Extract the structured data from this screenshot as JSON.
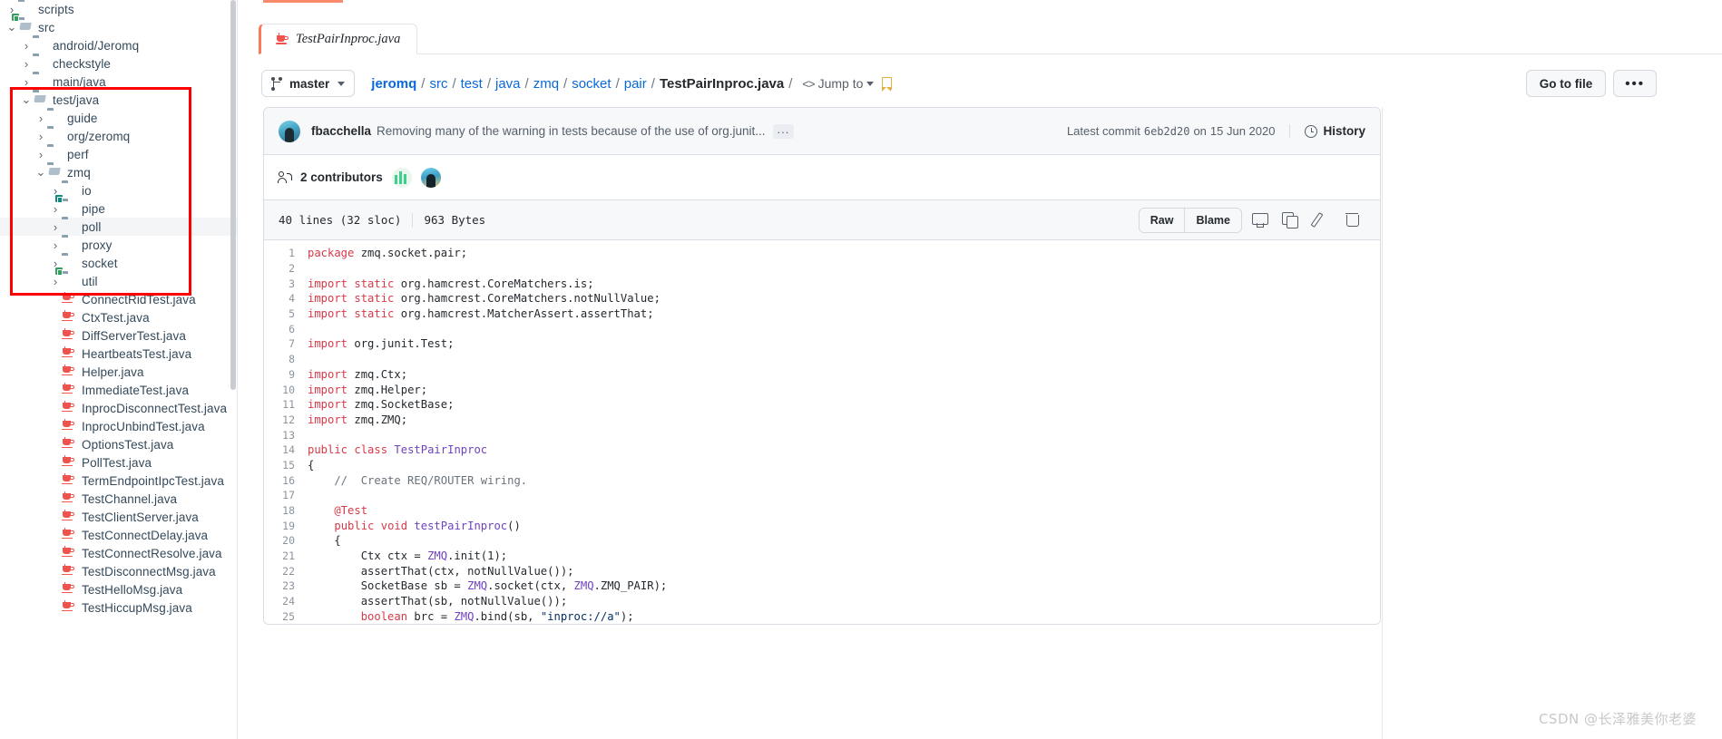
{
  "sidebar": {
    "scrollbar": true,
    "tree": [
      {
        "label": "scripts",
        "type": "folder",
        "icon": "folder-icon",
        "depth": 0,
        "twisty": "collapsed",
        "selected": false,
        "variant": "plain"
      },
      {
        "label": "src",
        "type": "folder",
        "icon": "folder-open-icon",
        "depth": 0,
        "twisty": "expanded",
        "selected": false,
        "variant": "green"
      },
      {
        "label": "android/Jeromq",
        "type": "folder",
        "icon": "folder-icon",
        "depth": 1,
        "twisty": "collapsed",
        "selected": false,
        "variant": "plain"
      },
      {
        "label": "checkstyle",
        "type": "folder",
        "icon": "folder-icon",
        "depth": 1,
        "twisty": "collapsed",
        "selected": false,
        "variant": "plain"
      },
      {
        "label": "main/java",
        "type": "folder",
        "icon": "folder-icon",
        "depth": 1,
        "twisty": "collapsed",
        "selected": false,
        "variant": "plain"
      },
      {
        "label": "test/java",
        "type": "folder",
        "icon": "folder-open-icon",
        "depth": 1,
        "twisty": "expanded",
        "selected": false,
        "variant": "plain"
      },
      {
        "label": "guide",
        "type": "folder",
        "icon": "folder-icon",
        "depth": 2,
        "twisty": "collapsed",
        "selected": false,
        "variant": "plain"
      },
      {
        "label": "org/zeromq",
        "type": "folder",
        "icon": "folder-icon",
        "depth": 2,
        "twisty": "collapsed",
        "selected": false,
        "variant": "plain"
      },
      {
        "label": "perf",
        "type": "folder",
        "icon": "folder-icon",
        "depth": 2,
        "twisty": "collapsed",
        "selected": false,
        "variant": "plain"
      },
      {
        "label": "zmq",
        "type": "folder",
        "icon": "folder-open-icon",
        "depth": 2,
        "twisty": "expanded",
        "selected": false,
        "variant": "plain"
      },
      {
        "label": "io",
        "type": "folder",
        "icon": "folder-icon",
        "depth": 3,
        "twisty": "collapsed",
        "selected": false,
        "variant": "plain"
      },
      {
        "label": "pipe",
        "type": "folder",
        "icon": "folder-icon",
        "depth": 3,
        "twisty": "collapsed",
        "selected": false,
        "variant": "teal"
      },
      {
        "label": "poll",
        "type": "folder",
        "icon": "folder-icon",
        "depth": 3,
        "twisty": "collapsed",
        "selected": true,
        "variant": "plain"
      },
      {
        "label": "proxy",
        "type": "folder",
        "icon": "folder-icon",
        "depth": 3,
        "twisty": "collapsed",
        "selected": false,
        "variant": "plain"
      },
      {
        "label": "socket",
        "type": "folder",
        "icon": "folder-icon",
        "depth": 3,
        "twisty": "collapsed",
        "selected": false,
        "variant": "plain"
      },
      {
        "label": "util",
        "type": "folder",
        "icon": "folder-icon",
        "depth": 3,
        "twisty": "collapsed",
        "selected": false,
        "variant": "green"
      },
      {
        "label": "ConnectRidTest.java",
        "type": "file",
        "icon": "java-file-icon",
        "depth": 3,
        "twisty": "none",
        "selected": false,
        "variant": "plain"
      },
      {
        "label": "CtxTest.java",
        "type": "file",
        "icon": "java-file-icon",
        "depth": 3,
        "twisty": "none",
        "selected": false,
        "variant": "plain"
      },
      {
        "label": "DiffServerTest.java",
        "type": "file",
        "icon": "java-file-icon",
        "depth": 3,
        "twisty": "none",
        "selected": false,
        "variant": "plain"
      },
      {
        "label": "HeartbeatsTest.java",
        "type": "file",
        "icon": "java-file-icon",
        "depth": 3,
        "twisty": "none",
        "selected": false,
        "variant": "plain"
      },
      {
        "label": "Helper.java",
        "type": "file",
        "icon": "java-file-icon",
        "depth": 3,
        "twisty": "none",
        "selected": false,
        "variant": "plain"
      },
      {
        "label": "ImmediateTest.java",
        "type": "file",
        "icon": "java-file-icon",
        "depth": 3,
        "twisty": "none",
        "selected": false,
        "variant": "plain"
      },
      {
        "label": "InprocDisconnectTest.java",
        "type": "file",
        "icon": "java-file-icon",
        "depth": 3,
        "twisty": "none",
        "selected": false,
        "variant": "plain"
      },
      {
        "label": "InprocUnbindTest.java",
        "type": "file",
        "icon": "java-file-icon",
        "depth": 3,
        "twisty": "none",
        "selected": false,
        "variant": "plain"
      },
      {
        "label": "OptionsTest.java",
        "type": "file",
        "icon": "java-file-icon",
        "depth": 3,
        "twisty": "none",
        "selected": false,
        "variant": "plain"
      },
      {
        "label": "PollTest.java",
        "type": "file",
        "icon": "java-file-icon",
        "depth": 3,
        "twisty": "none",
        "selected": false,
        "variant": "plain"
      },
      {
        "label": "TermEndpointIpcTest.java",
        "type": "file",
        "icon": "java-file-icon",
        "depth": 3,
        "twisty": "none",
        "selected": false,
        "variant": "plain"
      },
      {
        "label": "TestChannel.java",
        "type": "file",
        "icon": "java-file-icon",
        "depth": 3,
        "twisty": "none",
        "selected": false,
        "variant": "plain"
      },
      {
        "label": "TestClientServer.java",
        "type": "file",
        "icon": "java-file-icon",
        "depth": 3,
        "twisty": "none",
        "selected": false,
        "variant": "plain"
      },
      {
        "label": "TestConnectDelay.java",
        "type": "file",
        "icon": "java-file-icon",
        "depth": 3,
        "twisty": "none",
        "selected": false,
        "variant": "plain"
      },
      {
        "label": "TestConnectResolve.java",
        "type": "file",
        "icon": "java-file-icon",
        "depth": 3,
        "twisty": "none",
        "selected": false,
        "variant": "plain"
      },
      {
        "label": "TestDisconnectMsg.java",
        "type": "file",
        "icon": "java-file-icon",
        "depth": 3,
        "twisty": "none",
        "selected": false,
        "variant": "plain"
      },
      {
        "label": "TestHelloMsg.java",
        "type": "file",
        "icon": "java-file-icon",
        "depth": 3,
        "twisty": "none",
        "selected": false,
        "variant": "plain"
      },
      {
        "label": "TestHiccupMsg.java",
        "type": "file",
        "icon": "java-file-icon",
        "depth": 3,
        "twisty": "none",
        "selected": false,
        "variant": "plain"
      }
    ]
  },
  "annotation": {
    "color": "#fe0000",
    "shape": "rectangle"
  },
  "tab": {
    "label": "TestPairInproc.java",
    "icon": "java-file-icon",
    "accent_color": "#fb7a5b"
  },
  "breadcrumb": {
    "branch": "master",
    "segments": [
      "jeromq",
      "src",
      "test",
      "java",
      "zmq",
      "socket",
      "pair",
      "TestPairInproc.java"
    ],
    "separator": "/",
    "jump_to": "Jump to",
    "bookmark_icon": "bookmark-icon"
  },
  "header_actions": {
    "go_to_file": "Go to file",
    "more": "•••"
  },
  "commit": {
    "author": "fbacchella",
    "message": "Removing many of the warning in tests because of the use of org.junit...",
    "ellipsis": "...",
    "latest_label": "Latest commit",
    "sha": "6eb2d20",
    "date_prefix": "on",
    "date": "15 Jun 2020",
    "history": "History"
  },
  "contributors": {
    "count_label": "2 contributors",
    "avatars": 2
  },
  "file_toolbar": {
    "lines": "40 lines (32 sloc)",
    "size": "963 Bytes",
    "raw": "Raw",
    "blame": "Blame",
    "icons": [
      "display-icon",
      "copy-icon",
      "pencil-icon",
      "trash-icon"
    ]
  },
  "code": {
    "language": "java",
    "lines": [
      {
        "n": 1,
        "tokens": [
          {
            "t": "package ",
            "c": "k"
          },
          {
            "t": "zmq.socket.pair;",
            "c": "nm"
          }
        ]
      },
      {
        "n": 2,
        "tokens": []
      },
      {
        "n": 3,
        "tokens": [
          {
            "t": "import ",
            "c": "k"
          },
          {
            "t": "static ",
            "c": "k"
          },
          {
            "t": "org.hamcrest.CoreMatchers.is;",
            "c": "nm"
          }
        ]
      },
      {
        "n": 4,
        "tokens": [
          {
            "t": "import ",
            "c": "k"
          },
          {
            "t": "static ",
            "c": "k"
          },
          {
            "t": "org.hamcrest.CoreMatchers.notNullValue;",
            "c": "nm"
          }
        ]
      },
      {
        "n": 5,
        "tokens": [
          {
            "t": "import ",
            "c": "k"
          },
          {
            "t": "static ",
            "c": "k"
          },
          {
            "t": "org.hamcrest.MatcherAssert.assertThat;",
            "c": "nm"
          }
        ]
      },
      {
        "n": 6,
        "tokens": []
      },
      {
        "n": 7,
        "tokens": [
          {
            "t": "import ",
            "c": "k"
          },
          {
            "t": "org.junit.Test;",
            "c": "nm"
          }
        ]
      },
      {
        "n": 8,
        "tokens": []
      },
      {
        "n": 9,
        "tokens": [
          {
            "t": "import ",
            "c": "k"
          },
          {
            "t": "zmq.Ctx;",
            "c": "nm"
          }
        ]
      },
      {
        "n": 10,
        "tokens": [
          {
            "t": "import ",
            "c": "k"
          },
          {
            "t": "zmq.Helper;",
            "c": "nm"
          }
        ]
      },
      {
        "n": 11,
        "tokens": [
          {
            "t": "import ",
            "c": "k"
          },
          {
            "t": "zmq.SocketBase;",
            "c": "nm"
          }
        ]
      },
      {
        "n": 12,
        "tokens": [
          {
            "t": "import ",
            "c": "k"
          },
          {
            "t": "zmq.ZMQ;",
            "c": "nm"
          }
        ]
      },
      {
        "n": 13,
        "tokens": []
      },
      {
        "n": 14,
        "tokens": [
          {
            "t": "public ",
            "c": "k"
          },
          {
            "t": "class ",
            "c": "k"
          },
          {
            "t": "TestPairInproc",
            "c": "ty"
          }
        ]
      },
      {
        "n": 15,
        "tokens": [
          {
            "t": "{",
            "c": "nm"
          }
        ]
      },
      {
        "n": 16,
        "tokens": [
          {
            "t": "    //  Create REQ/ROUTER wiring.",
            "c": "cm"
          }
        ]
      },
      {
        "n": 17,
        "tokens": []
      },
      {
        "n": 18,
        "tokens": [
          {
            "t": "    @Test",
            "c": "an"
          }
        ]
      },
      {
        "n": 19,
        "tokens": [
          {
            "t": "    ",
            "c": "nm"
          },
          {
            "t": "public ",
            "c": "k"
          },
          {
            "t": "void ",
            "c": "k"
          },
          {
            "t": "testPairInproc",
            "c": "ty"
          },
          {
            "t": "()",
            "c": "nm"
          }
        ]
      },
      {
        "n": 20,
        "tokens": [
          {
            "t": "    {",
            "c": "nm"
          }
        ]
      },
      {
        "n": 21,
        "tokens": [
          {
            "t": "        Ctx ctx = ",
            "c": "nm"
          },
          {
            "t": "ZMQ",
            "c": "ty"
          },
          {
            "t": ".init(",
            "c": "nm"
          },
          {
            "t": "1",
            "c": "nm"
          },
          {
            "t": ");",
            "c": "nm"
          }
        ]
      },
      {
        "n": 22,
        "tokens": [
          {
            "t": "        assertThat(ctx, notNullValue());",
            "c": "nm"
          }
        ]
      },
      {
        "n": 23,
        "tokens": [
          {
            "t": "        SocketBase sb = ",
            "c": "nm"
          },
          {
            "t": "ZMQ",
            "c": "ty"
          },
          {
            "t": ".socket(ctx, ",
            "c": "nm"
          },
          {
            "t": "ZMQ",
            "c": "ty"
          },
          {
            "t": ".ZMQ_PAIR);",
            "c": "nm"
          }
        ]
      },
      {
        "n": 24,
        "tokens": [
          {
            "t": "        assertThat(sb, notNullValue());",
            "c": "nm"
          }
        ]
      },
      {
        "n": 25,
        "tokens": [
          {
            "t": "        ",
            "c": "nm"
          },
          {
            "t": "boolean ",
            "c": "k"
          },
          {
            "t": "brc = ",
            "c": "nm"
          },
          {
            "t": "ZMQ",
            "c": "ty"
          },
          {
            "t": ".bind(sb, ",
            "c": "nm"
          },
          {
            "t": "\"inproc://a\"",
            "c": "st"
          },
          {
            "t": ");",
            "c": "nm"
          }
        ]
      }
    ]
  },
  "watermark": "CSDN @长泽雅美你老婆"
}
